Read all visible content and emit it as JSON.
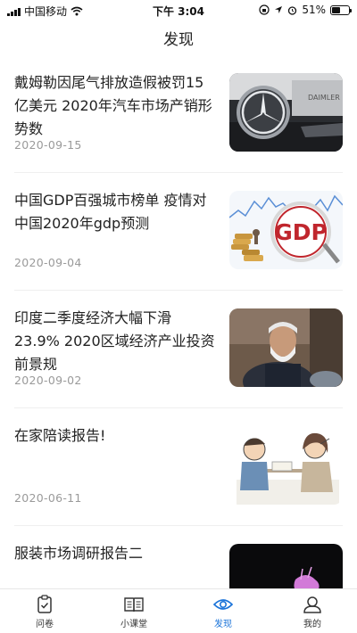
{
  "status_bar": {
    "carrier": "中国移动",
    "time": "下午 3:04",
    "battery": "51%",
    "battery_level": 0.51
  },
  "header": {
    "title": "发现"
  },
  "articles": [
    {
      "title": "戴姆勒因尾气排放造假被罚15亿美元 2020年汽车市场产销形势数",
      "date": "2020-09-15",
      "image_text": "DAIMLER"
    },
    {
      "title": "中国GDP百强城市榜单 疫情对中国2020年gdp预测",
      "date": "2020-09-04",
      "image_text": "GDP"
    },
    {
      "title": "印度二季度经济大幅下滑23.9% 2020区域经济产业投资前景规",
      "date": "2020-09-02"
    },
    {
      "title": "在家陪读报告!",
      "date": "2020-06-11"
    },
    {
      "title": "服装市场调研报告二",
      "date": ""
    }
  ],
  "tabs": [
    {
      "label": "问卷",
      "icon": "questionnaire-icon",
      "active": false
    },
    {
      "label": "小课堂",
      "icon": "book-icon",
      "active": false
    },
    {
      "label": "发现",
      "icon": "eye-icon",
      "active": true
    },
    {
      "label": "我的",
      "icon": "user-icon",
      "active": false
    }
  ],
  "colors": {
    "accent": "#1a73d9",
    "date": "#9a9a9a",
    "divider": "#efefef"
  }
}
